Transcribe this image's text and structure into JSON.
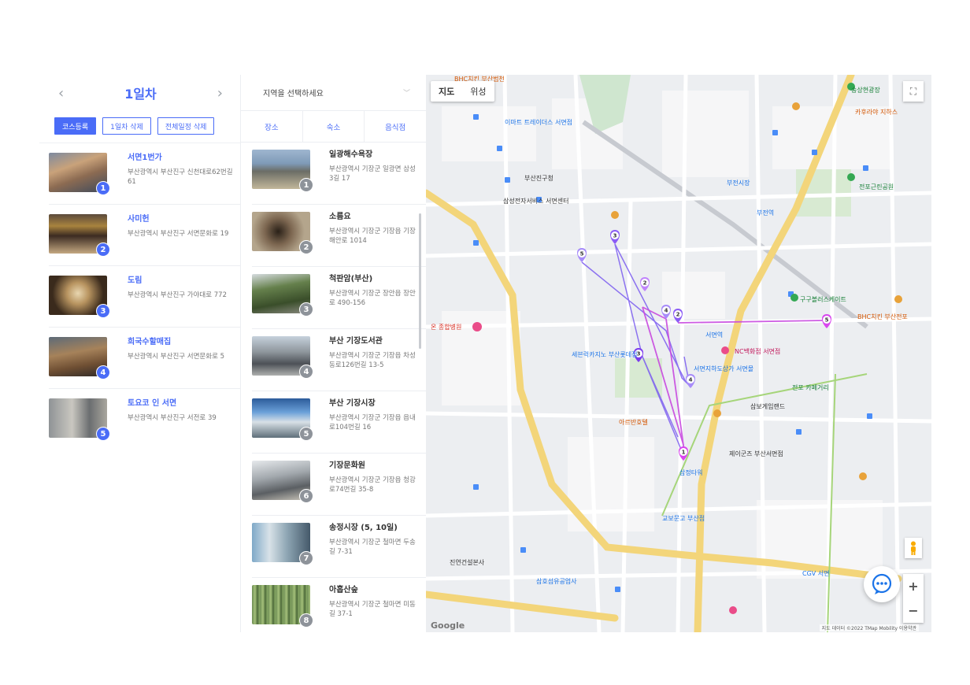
{
  "course": {
    "day_title": "1일차",
    "prev_arrow": "‹",
    "next_arrow": "›",
    "buttons": {
      "register": "코스등록",
      "delete_day": "1일차 삭제",
      "delete_all": "전체일정 삭제"
    },
    "items": [
      {
        "num": "1",
        "name": "서면1번가",
        "address": "부산광역시 부산진구 신천대로62번길 61"
      },
      {
        "num": "2",
        "name": "사미헌",
        "address": "부산광역시 부산진구 서면문화로 19"
      },
      {
        "num": "3",
        "name": "도림",
        "address": "부산광역시 부산진구 가야대로 772"
      },
      {
        "num": "4",
        "name": "희국수할매집",
        "address": "부산광역시 부산진구 서면문화로 5"
      },
      {
        "num": "5",
        "name": "토요코 인 서면",
        "address": "부산광역시 부산진구 서전로 39"
      }
    ]
  },
  "places": {
    "region_placeholder": "지역을 선택하세요",
    "tabs": [
      "장소",
      "숙소",
      "음식점"
    ],
    "items": [
      {
        "num": "1",
        "name": "일광해수욕장",
        "address": "부산광역시 기장군 일광면 삼성3길 17"
      },
      {
        "num": "2",
        "name": "소름요",
        "address": "부산광역시 기장군 기장읍 기장해안로 1014"
      },
      {
        "num": "3",
        "name": "척판암(부산)",
        "address": "부산광역시 기장군 장안읍 장안로 490-156"
      },
      {
        "num": "4",
        "name": "부산 기장도서관",
        "address": "부산광역시 기장군 기장읍 차성동로126번길 13-5"
      },
      {
        "num": "5",
        "name": "부산 기장시장",
        "address": "부산광역시 기장군 기장읍 읍내로104번길 16"
      },
      {
        "num": "6",
        "name": "기장문화원",
        "address": "부산광역시 기장군 기장읍 청강로74번길 35-8"
      },
      {
        "num": "7",
        "name": "송정시장 (5, 10일)",
        "address": "부산광역시 기장군 철마면 두송길 7-31"
      },
      {
        "num": "8",
        "name": "아홉산숲",
        "address": "부산광역시 기장군 철마면 미동길 37-1"
      }
    ]
  },
  "map": {
    "type_map": "지도",
    "type_satellite": "위성",
    "zoom_in": "+",
    "zoom_out": "−",
    "google": "Google",
    "attribution": "지도 데이터 ©2022 TMap Mobility  이용약관",
    "labels": {
      "bhc_top": "BHC치킨 부산범천",
      "emart": "이마트 트레이더스 서면점",
      "songsang_park": "송상현광장",
      "kahuraya": "카후라야 지하스",
      "bujeon": "부전역",
      "bujeon_market": "부전시장",
      "hospital": "온 종합병원",
      "sewon": "세븐럭카지노 부산롯데점",
      "lotte_hotel": "아르반호텔",
      "samjeong": "삼정타워",
      "gyobo": "교보문고 부산점",
      "cgv": "CGV 서면",
      "nc": "NC백화점 서면점",
      "underground": "서면지하도상가 서면몰",
      "sansung": "삼보게임랜드",
      "jeju": "제이군즈 부산서면점",
      "junpo": "전포 카페거리",
      "gugu": "구구볼러스케이트",
      "seomyeon": "서면역",
      "jinyeon": "진연건설본사",
      "samho": "삼호섬유공업사",
      "jingu": "부산진구청",
      "samsung": "삼성전자서비스 서면센터",
      "jeonpo_gongwon": "전포근린공원",
      "bhc_jeonpo": "BHC치킨 부산전포"
    }
  }
}
